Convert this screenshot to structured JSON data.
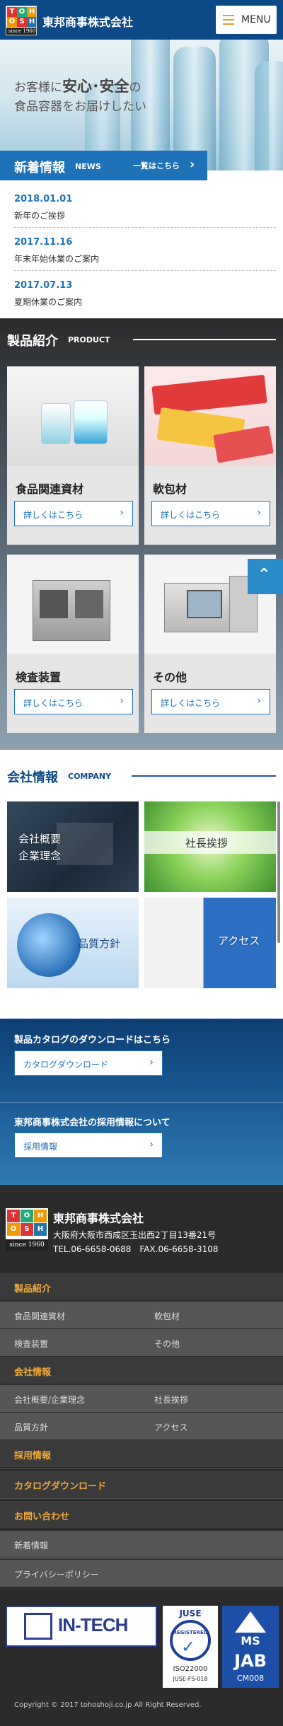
{
  "header": {
    "logo_letters": [
      "T",
      "O",
      "H",
      "O",
      "S",
      "H",
      "O",
      "J",
      "I"
    ],
    "logo_since": "since 1960",
    "company_name": "東邦商事株式会社",
    "menu_label": "MENU"
  },
  "hero": {
    "line1_pre": "お客様に",
    "line1_bold": "安心･安全",
    "line1_post": "の",
    "line2": "食品容器をお届けしたい"
  },
  "news": {
    "title": "新着情報",
    "subtitle": "NEWS",
    "all_link": "一覧はこちら",
    "items": [
      {
        "date": "2018.01.01",
        "text": "新年のご挨拶"
      },
      {
        "date": "2017.11.16",
        "text": "年末年始休業のご案内"
      },
      {
        "date": "2017.07.13",
        "text": "夏期休業のご案内"
      }
    ]
  },
  "products": {
    "title": "製品紹介",
    "subtitle": "PRODUCT",
    "button_label": "詳しくはこちら",
    "items": [
      {
        "name": "食品関連資材"
      },
      {
        "name": "軟包材"
      },
      {
        "name": "検査装置"
      },
      {
        "name": "その他"
      }
    ]
  },
  "company": {
    "title": "会社情報",
    "subtitle": "COMPANY",
    "tiles": [
      {
        "label_line1": "会社概要",
        "label_line2": "企業理念"
      },
      {
        "label_line1": "社長挨拶",
        "label_line2": ""
      },
      {
        "label_line1": "品質方針",
        "label_line2": ""
      },
      {
        "label_line1": "アクセス",
        "label_line2": ""
      }
    ]
  },
  "catalog": {
    "title": "製品カタログのダウンロードはこちら",
    "button": "カタログダウンロード",
    "recruit_title": "東邦商事株式会社の採用情報について",
    "recruit_button": "採用情報"
  },
  "footer": {
    "company_name": "東邦商事株式会社",
    "address": "大阪府大阪市西成区玉出西2丁目13番21号",
    "tel": "TEL.06-6658-0688　FAX.06-6658-3108",
    "nav": {
      "products_heading": "製品紹介",
      "products": [
        "食品関連資材",
        "軟包材",
        "検査装置",
        "その他"
      ],
      "company_heading": "会社情報",
      "company": [
        "会社概要/企業理念",
        "社長挨拶",
        "品質方針",
        "アクセス"
      ],
      "recruit": "採用情報",
      "catalog": "カタログダウンロード",
      "contact": "お問い合わせ",
      "news": "新着情報",
      "privacy": "プライバシーポリシー"
    },
    "badges": {
      "intech": "IN-TECH",
      "juse_top": "JUSE",
      "juse_ring": "REGISTERED",
      "juse_iso": "ISO22000",
      "juse_code": "JUSE-FS-018",
      "jab_ms": "MS",
      "jab_name": "JAB",
      "jab_code": "CM008"
    },
    "copyright": "Copyright © 2017 tohoshoji.co.jp All Right Reserved."
  },
  "colors": {
    "brand_blue": "#0b4a86",
    "accent_blue": "#1e72b8",
    "orange": "#f0a93a"
  }
}
